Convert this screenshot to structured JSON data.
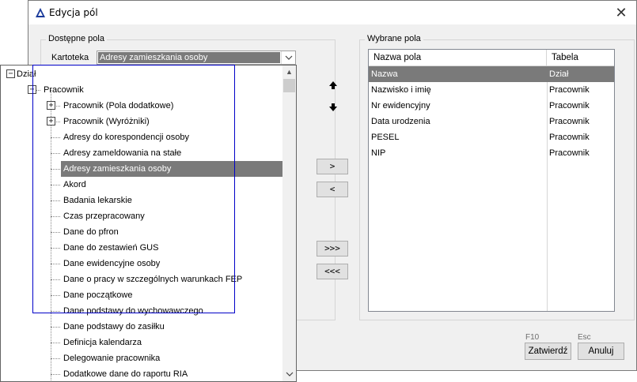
{
  "window": {
    "title": "Edycja pól"
  },
  "available": {
    "legend": "Dostępne pola",
    "kartoteka_label": "Kartoteka",
    "kartoteka_value": "Adresy zamieszkania osoby"
  },
  "tree": {
    "root": "Dział",
    "child": "Pracownik",
    "groups": [
      "Pracownik (Pola dodatkowe)",
      "Pracownik (Wyróżniki)"
    ],
    "items": [
      "Adresy do korespondencji osoby",
      "Adresy zameldowania na stałe",
      "Adresy zamieszkania osoby",
      "Akord",
      "Badania lekarskie",
      "Czas przepracowany",
      "Dane do pfron",
      "Dane do zestawień GUS",
      "Dane ewidencyjne osoby",
      "Dane o pracy w szczególnych warunkach FEP",
      "Dane początkowe",
      "Dane podstawy do wychowawczego",
      "Dane podstawy do zasiłku",
      "Definicja kalendarza",
      "Delegowanie pracownika",
      "Dodatkowe dane do raportu RIA"
    ],
    "selected_item": "Adresy zamieszkania osoby"
  },
  "transfer_buttons": {
    "add": ">",
    "remove": "<",
    "add_all": ">>>",
    "remove_all": "<<<"
  },
  "selected": {
    "legend": "Wybrane pola",
    "columns": {
      "name": "Nazwa pola",
      "table": "Tabela"
    },
    "rows": [
      {
        "name": "Nazwa",
        "table": "Dział"
      },
      {
        "name": "Nazwisko i imię",
        "table": "Pracownik"
      },
      {
        "name": "Nr ewidencyjny",
        "table": "Pracownik"
      },
      {
        "name": "Data urodzenia",
        "table": "Pracownik"
      },
      {
        "name": "PESEL",
        "table": "Pracownik"
      },
      {
        "name": "NIP",
        "table": "Pracownik"
      }
    ],
    "selected_row": 0
  },
  "footer": {
    "confirm_shortcut": "F10",
    "confirm_label": "Zatwierdź",
    "cancel_shortcut": "Esc",
    "cancel_label": "Anuluj"
  },
  "colors": {
    "selection": "#7a7a7a",
    "focus": "#0000c8",
    "title_icon": "#1a3a9a"
  }
}
